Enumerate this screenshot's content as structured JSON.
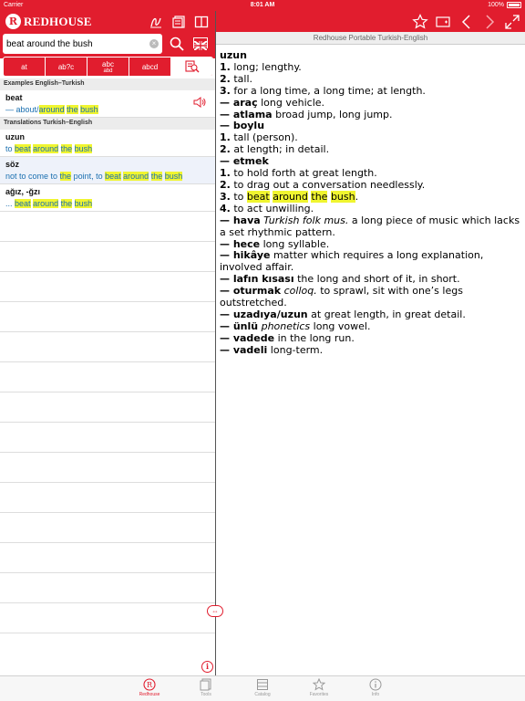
{
  "status_bar": {
    "carrier": "Carrier",
    "time": "8:01 AM",
    "battery": "100%"
  },
  "app": {
    "brand": "REDHOUSE",
    "logo_letter": "R"
  },
  "search": {
    "value": "beat around the bush",
    "placeholder": ""
  },
  "modes": [
    {
      "label": "at",
      "icon": "exact-search-icon"
    },
    {
      "label": "ab?c",
      "icon": "wildcard-search-icon"
    },
    {
      "label": "abc",
      "sub": "abd",
      "icon": "fuzzy-search-icon"
    },
    {
      "label": "abcd",
      "icon": "reverse-search-icon"
    },
    {
      "label": "",
      "icon": "fulltext-search-icon",
      "active": true
    }
  ],
  "sections": {
    "examples": "Examples English–Turkish",
    "translations": "Translations Turkish–English"
  },
  "results": {
    "examples": [
      {
        "headword": "beat",
        "pre": "— ",
        "p1": "about/",
        "h1": "around",
        "s1": " ",
        "h2": "the",
        "s2": " ",
        "h3": "bush"
      }
    ],
    "translations": [
      {
        "headword": "uzun",
        "pre": "to ",
        "h1": "beat",
        "s1": " ",
        "h2": "around",
        "s2": " ",
        "h3": "the",
        "s3": " ",
        "h4": "bush"
      },
      {
        "headword": "söz",
        "pre": "not to come to ",
        "h1": "the",
        "s1": " point, to ",
        "h2": "beat",
        "s2": " ",
        "h3": "around",
        "s3": " ",
        "h4": "the",
        "s4": " ",
        "h5": "bush"
      },
      {
        "headword": "ağız, -ğzı",
        "pre": "... ",
        "h1": "beat",
        "s1": " ",
        "h2": "around",
        "s2": " ",
        "h3": "the",
        "s3": " ",
        "h4": "bush"
      }
    ]
  },
  "right": {
    "subtitle": "Redhouse Portable Turkish-English",
    "article": {
      "headword": "uzun",
      "lines": [
        {
          "n": "1.",
          "t": " long; lengthy."
        },
        {
          "n": "2.",
          "t": " tall."
        },
        {
          "n": "3.",
          "t": " for a long time, a long time; at length."
        },
        {
          "b": "— araç",
          "t": " long vehicle."
        },
        {
          "b": "— atlama",
          "t": " broad jump, long jump."
        },
        {
          "b": "— boylu"
        },
        {
          "n": "1.",
          "t": " tall (person)."
        },
        {
          "n": "2.",
          "t": " at length; in detail."
        },
        {
          "b": "— etmek"
        },
        {
          "n": "1.",
          "t": " to hold forth at great length."
        },
        {
          "n": "2.",
          "t": " to drag out a conversation needlessly."
        },
        {
          "n": "3.",
          "t": " to "
        },
        {
          "n": "4.",
          "t": " to act unwilling."
        },
        {
          "b": "— hava",
          "i": " Turkish folk mus.",
          "t": " a long piece of music which lacks a set rhythmic pattern."
        },
        {
          "b": "— hece",
          "t": " long syllable."
        },
        {
          "b": "— hikâye",
          "t": " matter which requires a long explanation, involved affair."
        },
        {
          "b": "— lafın kısası",
          "t": " the long and short of it, in short."
        },
        {
          "b": "— oturmak",
          "i": " colloq.",
          "t": " to sprawl, sit with one’s legs outstretched."
        },
        {
          "b": "— uzadıya/uzun",
          "t": " at great length, in great detail."
        },
        {
          "b": "— ünlü",
          "i": " phonetics",
          "t": " long vowel."
        },
        {
          "b": "— vadede",
          "t": " in the long run."
        },
        {
          "b": "— vadeli",
          "t": " long-term."
        }
      ],
      "hl_words": [
        "beat",
        "around",
        "the",
        "bush"
      ]
    }
  },
  "tabbar": [
    {
      "label": "Redhouse",
      "icon": "redhouse-logo-icon",
      "active": true
    },
    {
      "label": "Tools",
      "icon": "tools-icon"
    },
    {
      "label": "Catalog",
      "icon": "catalog-icon"
    },
    {
      "label": "Favorites",
      "icon": "star-icon"
    },
    {
      "label": "Info",
      "icon": "info-icon"
    }
  ],
  "colors": {
    "accent": "#e11d2e",
    "highlight": "#f0f530",
    "link": "#1a6fb0"
  }
}
